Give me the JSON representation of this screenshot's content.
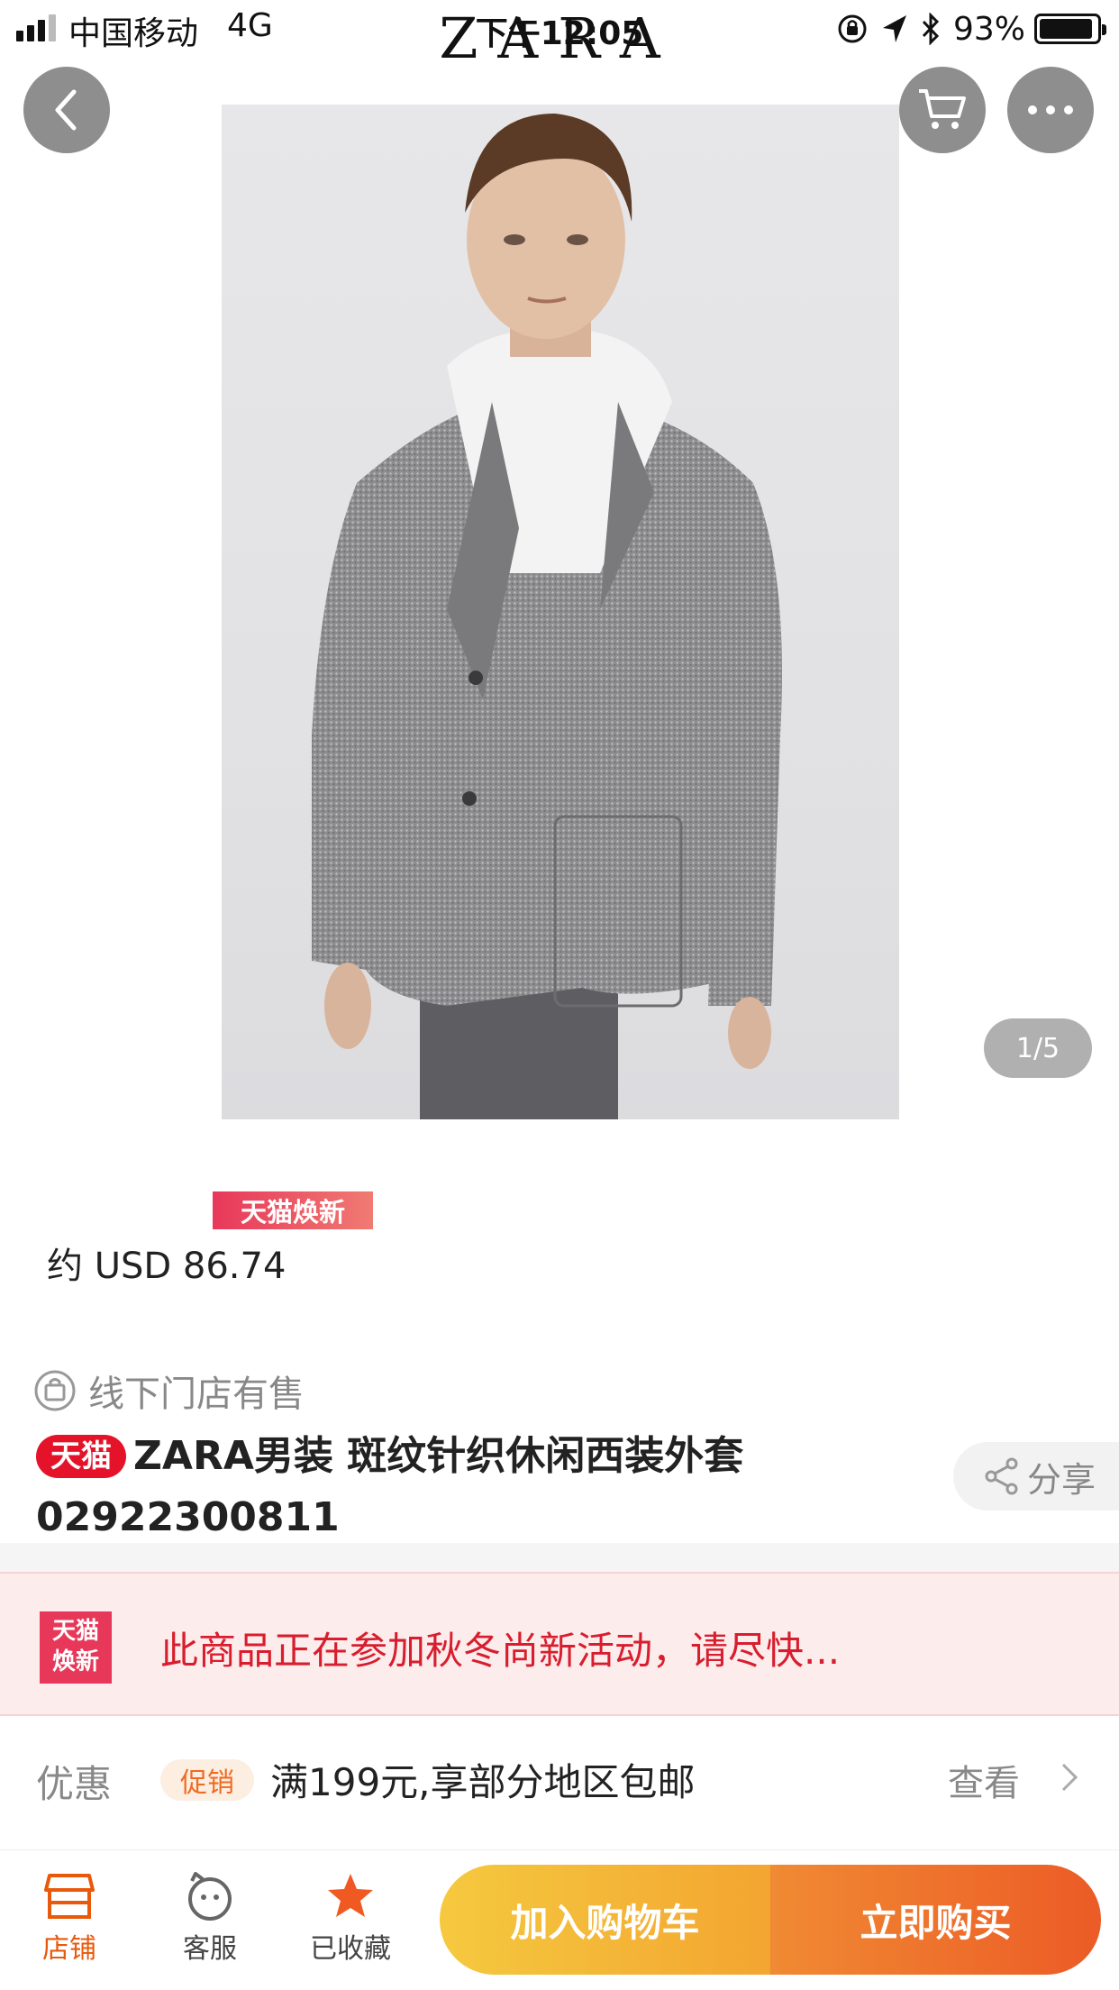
{
  "status_bar": {
    "carrier": "中国移动",
    "network": "4G",
    "time": "下午12:05",
    "battery": "93%",
    "battery_level": 0.93
  },
  "brand": "ZARA",
  "gallery": {
    "page_indicator": "1/5"
  },
  "price": {
    "promo_tag": "天猫焕新",
    "amount": "约 USD 86.74"
  },
  "store": {
    "offline_label": "线下门店有售"
  },
  "product": {
    "badge": "天猫",
    "title": "ZARA男装 斑纹针织休闲西装外套 02922300811"
  },
  "share": {
    "label": "分享"
  },
  "banner": {
    "badge_line1": "天猫",
    "badge_line2": "焕新",
    "text": "此商品正在参加秋冬尚新活动，请尽快..."
  },
  "coupon": {
    "label": "优惠",
    "tag": "促销",
    "text": "满199元,享部分地区包邮",
    "view": "查看"
  },
  "bottom_bar": {
    "store": "店铺",
    "service": "客服",
    "favorite": "已收藏",
    "add_to_cart": "加入购物车",
    "buy_now": "立即购买"
  },
  "colors": {
    "accent": "#e8590c",
    "tmall_red": "#e5132a",
    "add_cart": "#f3b534",
    "buy_now": "#ec5b26"
  },
  "icons": [
    "back-icon",
    "cart-icon",
    "more-icon",
    "bag-icon",
    "share-icon",
    "chevron-right-icon",
    "store-icon",
    "service-icon",
    "star-icon"
  ]
}
